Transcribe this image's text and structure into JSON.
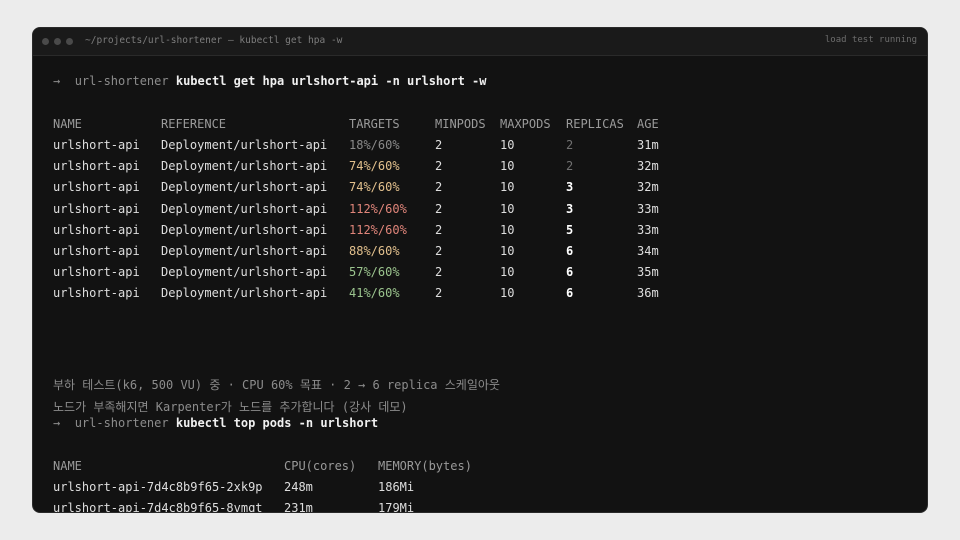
{
  "window": {
    "title": "~/projects/url-shortener — kubectl get hpa -w",
    "status": "load test running"
  },
  "prompt1": {
    "arrow": "→",
    "cwd": "url-shortener",
    "command": "kubectl get hpa urlshort-api -n urlshort -w"
  },
  "hpa": {
    "headers": [
      "NAME",
      "REFERENCE",
      "TARGETS",
      "MINPODS",
      "MAXPODS",
      "REPLICAS",
      "AGE"
    ],
    "rows": [
      {
        "name": "urlshort-api",
        "reference": "Deployment/urlshort-api",
        "targets": "18%/60%",
        "target_level": "gray",
        "minpods": "2",
        "maxpods": "10",
        "replicas": "2",
        "replicas_emph": false,
        "age": "31m"
      },
      {
        "name": "urlshort-api",
        "reference": "Deployment/urlshort-api",
        "targets": "74%/60%",
        "target_level": "yellow",
        "minpods": "2",
        "maxpods": "10",
        "replicas": "2",
        "replicas_emph": false,
        "age": "32m"
      },
      {
        "name": "urlshort-api",
        "reference": "Deployment/urlshort-api",
        "targets": "74%/60%",
        "target_level": "yellow",
        "minpods": "2",
        "maxpods": "10",
        "replicas": "3",
        "replicas_emph": true,
        "age": "32m"
      },
      {
        "name": "urlshort-api",
        "reference": "Deployment/urlshort-api",
        "targets": "112%/60%",
        "target_level": "red",
        "minpods": "2",
        "maxpods": "10",
        "replicas": "3",
        "replicas_emph": true,
        "age": "33m"
      },
      {
        "name": "urlshort-api",
        "reference": "Deployment/urlshort-api",
        "targets": "112%/60%",
        "target_level": "red",
        "minpods": "2",
        "maxpods": "10",
        "replicas": "5",
        "replicas_emph": true,
        "age": "33m"
      },
      {
        "name": "urlshort-api",
        "reference": "Deployment/urlshort-api",
        "targets": "88%/60%",
        "target_level": "yellow",
        "minpods": "2",
        "maxpods": "10",
        "replicas": "6",
        "replicas_emph": true,
        "age": "34m"
      },
      {
        "name": "urlshort-api",
        "reference": "Deployment/urlshort-api",
        "targets": "57%/60%",
        "target_level": "green",
        "minpods": "2",
        "maxpods": "10",
        "replicas": "6",
        "replicas_emph": true,
        "age": "35m"
      },
      {
        "name": "urlshort-api",
        "reference": "Deployment/urlshort-api",
        "targets": "41%/60%",
        "target_level": "green",
        "minpods": "2",
        "maxpods": "10",
        "replicas": "6",
        "replicas_emph": true,
        "age": "36m"
      }
    ]
  },
  "comments": [
    "부하 테스트(k6, 500 VU) 중 · CPU 60% 목표 · 2 → 6 replica 스케일아웃",
    "노드가 부족해지면 Karpenter가 노드를 추가합니다 (강사 데모)"
  ],
  "prompt2": {
    "arrow": "→",
    "cwd": "url-shortener",
    "command": "kubectl top pods -n urlshort"
  },
  "pods": {
    "headers": [
      "NAME",
      "CPU(cores)",
      "MEMORY(bytes)"
    ],
    "rows": [
      {
        "name": "urlshort-api-7d4c8b9f65-2xk9p",
        "cpu": "248m",
        "memory": "186Mi"
      },
      {
        "name": "urlshort-api-7d4c8b9f65-8vmqt",
        "cpu": "231m",
        "memory": "179Mi"
      }
    ]
  },
  "colors": {
    "background": "#121212",
    "gray": "#8a8a8a",
    "yellow": "#e2c08d",
    "red": "#e0857a",
    "green": "#9bc48e"
  }
}
